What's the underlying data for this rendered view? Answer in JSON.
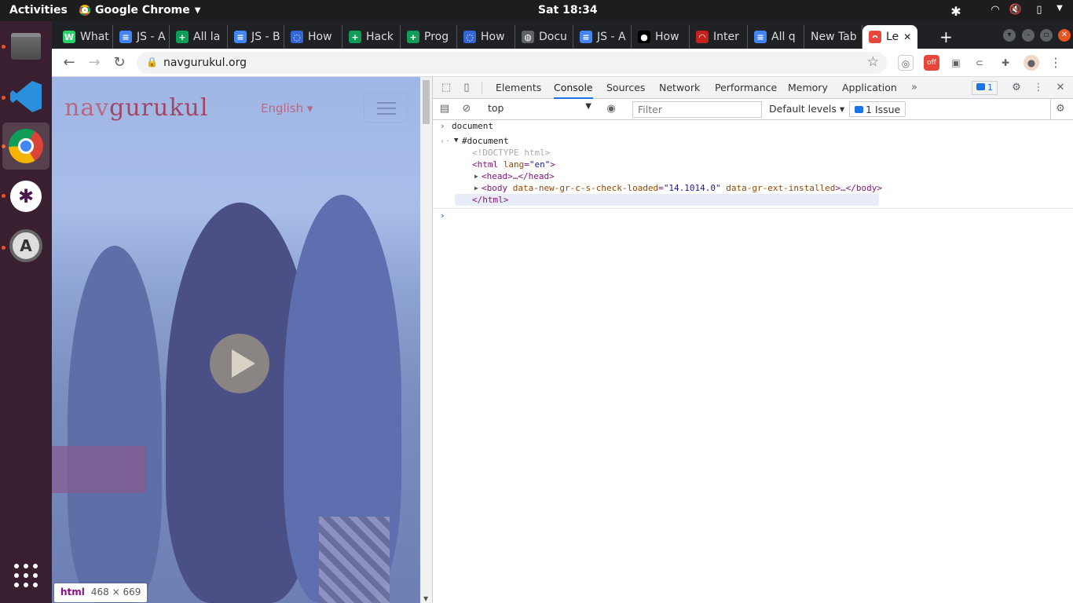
{
  "topbar": {
    "activities": "Activities",
    "app_name": "Google Chrome",
    "clock": "Sat 18:34"
  },
  "tabs": [
    {
      "label": "What",
      "fav_color": "#25d366",
      "fav_glyph": "W"
    },
    {
      "label": "JS - A",
      "fav_color": "#4285f4",
      "fav_glyph": "≡"
    },
    {
      "label": "All la",
      "fav_color": "#0f9d58",
      "fav_glyph": "+"
    },
    {
      "label": "JS - B",
      "fav_color": "#4285f4",
      "fav_glyph": "≡"
    },
    {
      "label": "How",
      "fav_color": "#3367d6",
      "fav_glyph": "◌"
    },
    {
      "label": "Hack",
      "fav_color": "#0f9d58",
      "fav_glyph": "+"
    },
    {
      "label": "Prog",
      "fav_color": "#0f9d58",
      "fav_glyph": "+"
    },
    {
      "label": "How",
      "fav_color": "#3367d6",
      "fav_glyph": "◌"
    },
    {
      "label": "Docu",
      "fav_color": "#5f6368",
      "fav_glyph": "◍"
    },
    {
      "label": "JS - A",
      "fav_color": "#4285f4",
      "fav_glyph": "≡"
    },
    {
      "label": "How",
      "fav_color": "#000000",
      "fav_glyph": "●"
    },
    {
      "label": "Inter",
      "fav_color": "#c5221f",
      "fav_glyph": "◠"
    },
    {
      "label": "All q",
      "fav_color": "#4285f4",
      "fav_glyph": "≡"
    },
    {
      "label": "New Tab",
      "fav_color": "",
      "fav_glyph": ""
    },
    {
      "label": "Le",
      "fav_color": "#e8453c",
      "fav_glyph": "ᴖ",
      "active": true
    }
  ],
  "address_bar": {
    "url": "navgurukul.org"
  },
  "page": {
    "logo_nav": "nav",
    "logo_gurukul": "gurukul",
    "language": "English ▾"
  },
  "element_tooltip": {
    "tag": "html",
    "size": "468 × 669"
  },
  "devtools": {
    "tabs": [
      "Elements",
      "Console",
      "Sources",
      "Network",
      "Performance",
      "Memory",
      "Application"
    ],
    "active_tab": "Console",
    "issues_badge": "1",
    "context": "top",
    "filter_placeholder": "Filter",
    "levels": "Default levels ▾",
    "issue_button": "1 Issue",
    "console": {
      "input": "document",
      "result_root": "#document",
      "doctype": "<!DOCTYPE html>",
      "html_open_tag": "html",
      "html_attr": "lang",
      "html_attr_val": "\"en\"",
      "head": "<head>…</head>",
      "body_tag": "body",
      "body_attr1": "data-new-gr-c-s-check-loaded",
      "body_attr1_val": "\"14.1014.0\"",
      "body_attr2": "data-gr-ext-installed",
      "body_close": ">…</body>",
      "html_close": "</html>"
    }
  },
  "colors": {
    "ubuntu_accent": "#e95420",
    "devtools_accent": "#1a73e8"
  }
}
